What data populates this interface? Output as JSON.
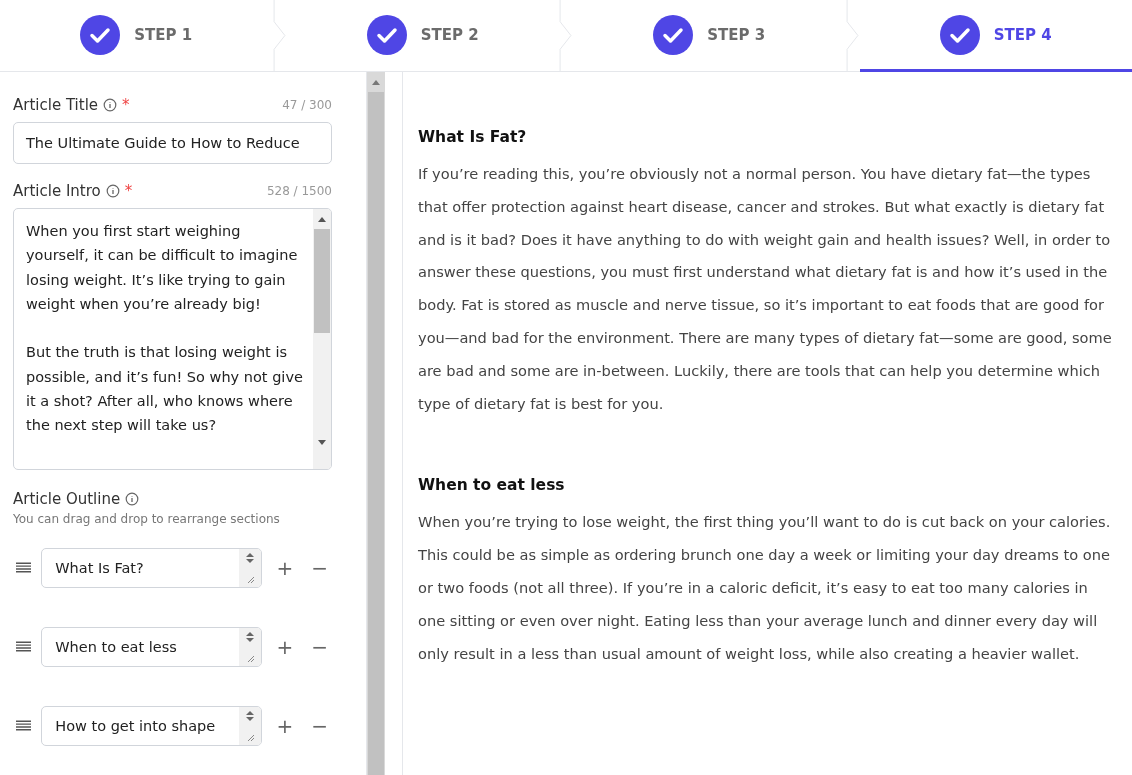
{
  "steps": [
    {
      "label": "STEP 1",
      "completed": true,
      "selected": false
    },
    {
      "label": "STEP 2",
      "completed": true,
      "selected": false
    },
    {
      "label": "STEP 3",
      "completed": true,
      "selected": false
    },
    {
      "label": "STEP 4",
      "completed": true,
      "selected": true
    }
  ],
  "form": {
    "title": {
      "label": "Article Title",
      "required_mark": "*",
      "count": "47 / 300",
      "value": "The Ultimate Guide to How to Reduce"
    },
    "intro": {
      "label": "Article Intro",
      "required_mark": "*",
      "count": "528 / 1500",
      "value": "When you first start weighing yourself, it can be difficult to imagine losing weight. It’s like trying to gain weight when you’re already big!\n\nBut the truth is that losing weight is possible, and it’s fun! So why not give it a shot? After all, who knows where the next step will take us?"
    },
    "outline": {
      "label": "Article Outline",
      "hint": "You can drag and drop to rearrange sections",
      "items": [
        {
          "value": "What Is Fat?"
        },
        {
          "value": "When to eat less"
        },
        {
          "value": "How to get into shape"
        }
      ],
      "add": "+",
      "remove": "−"
    }
  },
  "article": [
    {
      "heading": "What Is Fat?",
      "body": "If you’re reading this, you’re obviously not a normal person. You have dietary fat—the types that offer protection against heart disease, cancer and strokes. But what exactly is dietary fat and is it bad? Does it have anything to do with weight gain and health issues? Well, in order to answer these questions, you must first understand what dietary fat is and how it’s used in the body. Fat is stored as muscle and nerve tissue, so it’s important to eat foods that are good for you—and bad for the environment. There are many types of dietary fat—some are good, some are bad and some are in-between. Luckily, there are tools that can help you determine which type of dietary fat is best for you."
    },
    {
      "heading": "When to eat less",
      "body": "When you’re trying to lose weight, the first thing you’ll want to do is cut back on your calories. This could be as simple as ordering brunch one day a week or limiting your day dreams to one or two foods (not all three). If you’re in a caloric deficit, it’s easy to eat too many calories in one sitting or even over night. Eating less than your average lunch and dinner every day will only result in a less than usual amount of weight loss, while also creating a heavier wallet."
    }
  ]
}
